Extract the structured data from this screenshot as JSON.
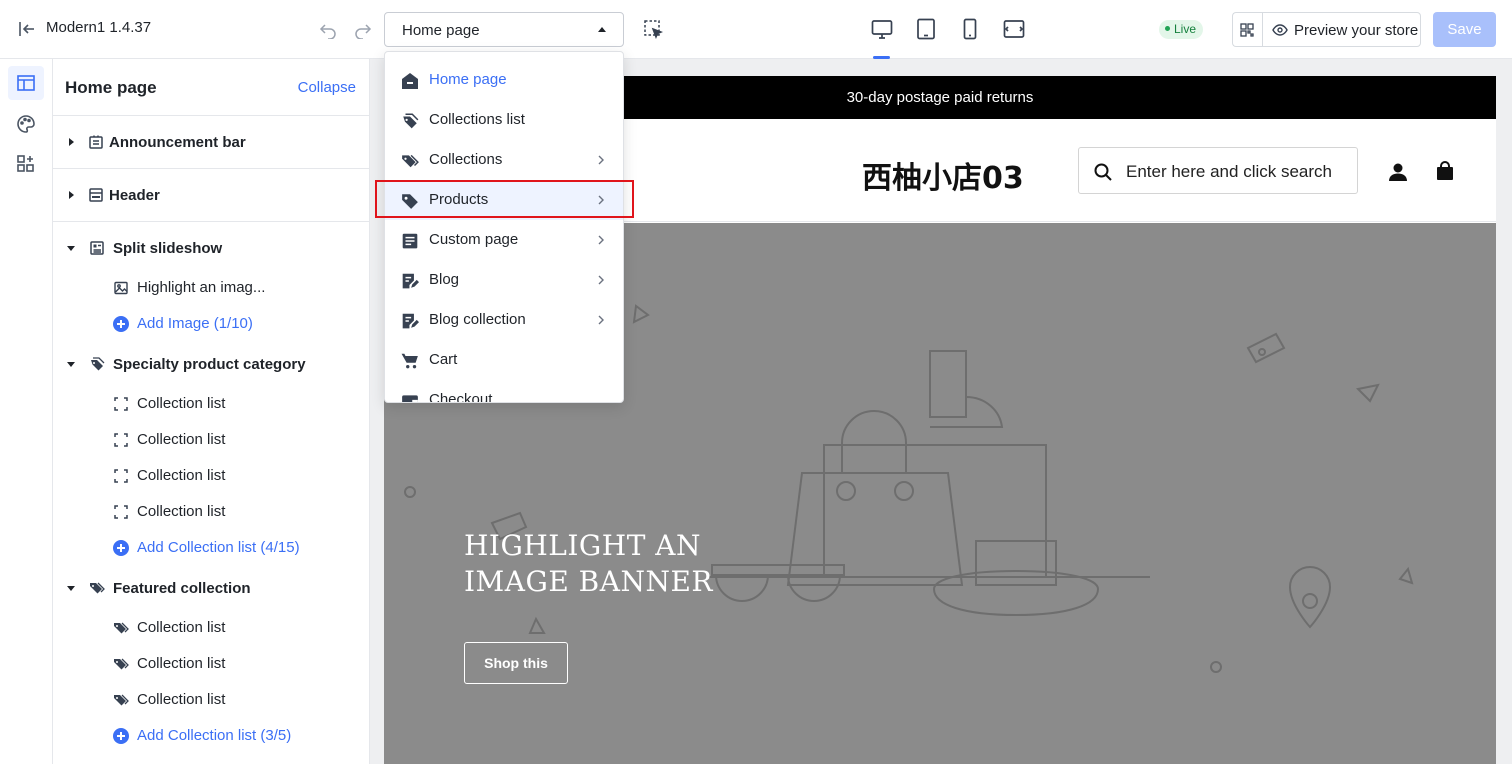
{
  "topbar": {
    "theme_name": "Modern1  1.4.37",
    "page_select": "Home page",
    "live_badge": "Live",
    "preview_label": "Preview your store",
    "save_label": "Save"
  },
  "sidebar": {
    "title": "Home page",
    "collapse_label": "Collapse",
    "sections": [
      {
        "label": "Announcement bar",
        "icon": "announcement-icon",
        "expanded": false
      },
      {
        "label": "Header",
        "icon": "header-icon",
        "expanded": false
      },
      {
        "label": "Split slideshow",
        "icon": "slideshow-icon",
        "expanded": true,
        "children": [
          {
            "label": "Highlight an imag...",
            "icon": "image-icon"
          }
        ],
        "add_label": "Add Image (1/10)"
      },
      {
        "label": "Specialty product category",
        "icon": "collections-icon",
        "expanded": true,
        "children": [
          {
            "label": "Collection list",
            "icon": "dashed-square-icon"
          },
          {
            "label": "Collection list",
            "icon": "dashed-square-icon"
          },
          {
            "label": "Collection list",
            "icon": "dashed-square-icon"
          },
          {
            "label": "Collection list",
            "icon": "dashed-square-icon"
          }
        ],
        "add_label": "Add Collection list (4/15)"
      },
      {
        "label": "Featured collection",
        "icon": "tags-icon",
        "expanded": true,
        "children": [
          {
            "label": "Collection list",
            "icon": "tags-icon"
          },
          {
            "label": "Collection list",
            "icon": "tags-icon"
          },
          {
            "label": "Collection list",
            "icon": "tags-icon"
          }
        ],
        "add_label": "Add Collection list (3/5)"
      }
    ]
  },
  "dropdown": {
    "items": [
      {
        "label": "Home page",
        "icon": "home-icon",
        "active": true,
        "has_submenu": false
      },
      {
        "label": "Collections list",
        "icon": "collections-icon",
        "active": false,
        "has_submenu": false
      },
      {
        "label": "Collections",
        "icon": "tags-icon",
        "active": false,
        "has_submenu": true
      },
      {
        "label": "Products",
        "icon": "tag-icon",
        "active": false,
        "has_submenu": true
      },
      {
        "label": "Custom page",
        "icon": "page-icon",
        "active": false,
        "has_submenu": true
      },
      {
        "label": "Blog",
        "icon": "blog-icon",
        "active": false,
        "has_submenu": true
      },
      {
        "label": "Blog collection",
        "icon": "blog-icon",
        "active": false,
        "has_submenu": true
      },
      {
        "label": "Cart",
        "icon": "cart-icon",
        "active": false,
        "has_submenu": false
      },
      {
        "label": "Checkout",
        "icon": "wallet-icon",
        "active": false,
        "has_submenu": false
      }
    ]
  },
  "store": {
    "announcement": "30-day postage paid returns",
    "name": "西柚小店03",
    "search_placeholder": "Enter here and click search",
    "hero_title_line1": "HIGHLIGHT AN",
    "hero_title_line2": "IMAGE BANNER",
    "hero_button": "Shop this"
  },
  "colors": {
    "accent": "#3b6ff5",
    "save_disabled": "#a9c0fb",
    "highlight": "#e0141b",
    "hero_bg": "#8b8b8b",
    "live_bg": "#e3f6e9"
  }
}
